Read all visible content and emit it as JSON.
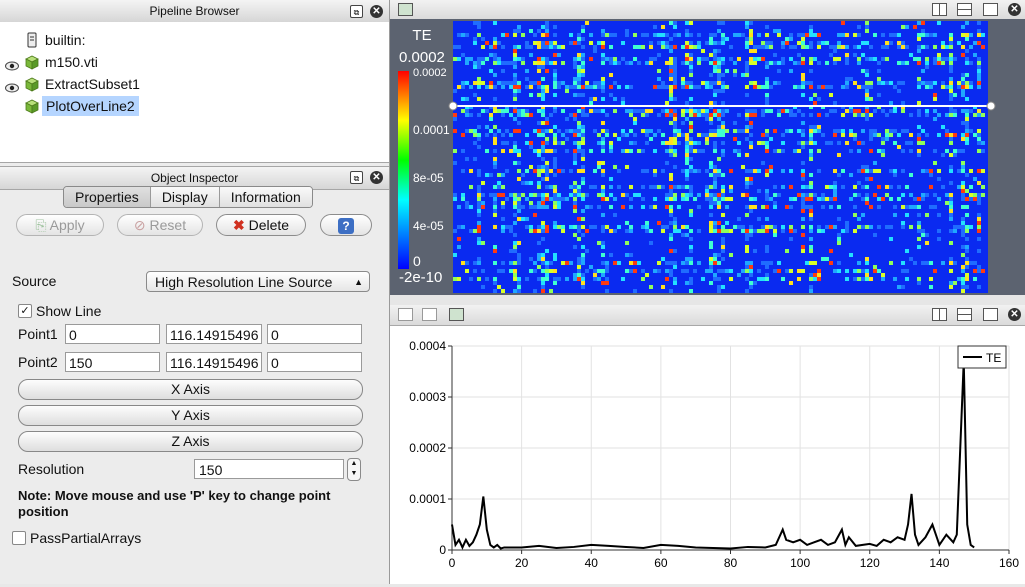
{
  "pipeline": {
    "title": "Pipeline Browser",
    "items": [
      {
        "label": "builtin:",
        "icon": "server-icon",
        "eye": false
      },
      {
        "label": "m150.vti",
        "icon": "cube-icon",
        "eye": true
      },
      {
        "label": "ExtractSubset1",
        "icon": "cube-icon",
        "eye": true
      },
      {
        "label": "PlotOverLine2",
        "icon": "cube-icon",
        "eye": false,
        "selected": true
      }
    ]
  },
  "inspector": {
    "title": "Object Inspector",
    "tabs": [
      "Properties",
      "Display",
      "Information"
    ],
    "buttons": {
      "apply": "Apply",
      "reset": "Reset",
      "delete": "Delete",
      "help": "?"
    },
    "source_label": "Source",
    "source_value": "High Resolution Line Source",
    "show_line": "Show Line",
    "point1_label": "Point1",
    "point1": [
      "0",
      "116.14915496",
      "0"
    ],
    "point2_label": "Point2",
    "point2": [
      "150",
      "116.14915496",
      "0"
    ],
    "x_axis": "X Axis",
    "y_axis": "Y Axis",
    "z_axis": "Z Axis",
    "resolution_label": "Resolution",
    "resolution": "150",
    "note": "Note: Move mouse and use 'P' key to change point position",
    "pass_partial": "PassPartialArrays"
  },
  "colorbar": {
    "title": "TE",
    "labels": [
      "0.0002",
      "0.0002",
      "0.0001",
      "8e-05",
      "4e-05",
      "0",
      "-2e-10"
    ]
  },
  "chart_data": {
    "type": "line",
    "title": "",
    "xlabel": "",
    "ylabel": "",
    "xlim": [
      0,
      160
    ],
    "ylim": [
      0,
      0.0004
    ],
    "x_ticks": [
      "0",
      "20",
      "40",
      "60",
      "80",
      "100",
      "120",
      "140",
      "160"
    ],
    "y_ticks": [
      "0",
      "0.0001",
      "0.0002",
      "0.0003",
      "0.0004"
    ],
    "legend": "top-right",
    "series": [
      {
        "name": "TE",
        "color": "#000000",
        "x": [
          0,
          1,
          2,
          3,
          4,
          5,
          6,
          7,
          8,
          9,
          10,
          11,
          12,
          13,
          14,
          15,
          20,
          25,
          30,
          35,
          40,
          45,
          50,
          55,
          60,
          65,
          70,
          75,
          80,
          85,
          90,
          93,
          95,
          96,
          98,
          100,
          102,
          104,
          106,
          108,
          110,
          112,
          113,
          114,
          116,
          118,
          120,
          122,
          124,
          126,
          128,
          130,
          131,
          132,
          133,
          134,
          136,
          138,
          139,
          140,
          142,
          144,
          145,
          146,
          147,
          148,
          149,
          150
        ],
        "y": [
          5e-05,
          1e-05,
          2e-05,
          5e-06,
          2e-05,
          8e-06,
          1.5e-05,
          3e-05,
          5e-05,
          0.000105,
          4e-05,
          1e-05,
          5e-06,
          1e-05,
          3e-06,
          5e-06,
          5e-06,
          8e-06,
          4e-06,
          6e-06,
          1e-05,
          8e-06,
          6e-06,
          4e-06,
          1e-05,
          8e-06,
          5e-06,
          4e-06,
          3e-06,
          6e-06,
          5e-06,
          1e-05,
          4e-05,
          2e-05,
          1.5e-05,
          2e-05,
          1e-05,
          1.5e-05,
          2e-05,
          1e-05,
          1.5e-05,
          4e-05,
          1e-05,
          2.5e-05,
          8e-06,
          1e-05,
          1.2e-05,
          8e-06,
          2e-05,
          1.5e-05,
          2.5e-05,
          2e-05,
          5e-05,
          0.00011,
          3e-05,
          1e-05,
          2.5e-05,
          5e-05,
          3e-05,
          1e-05,
          3e-05,
          1.5e-05,
          3e-05,
          0.0002,
          0.00037,
          5e-05,
          1e-05,
          5e-06
        ]
      }
    ]
  }
}
